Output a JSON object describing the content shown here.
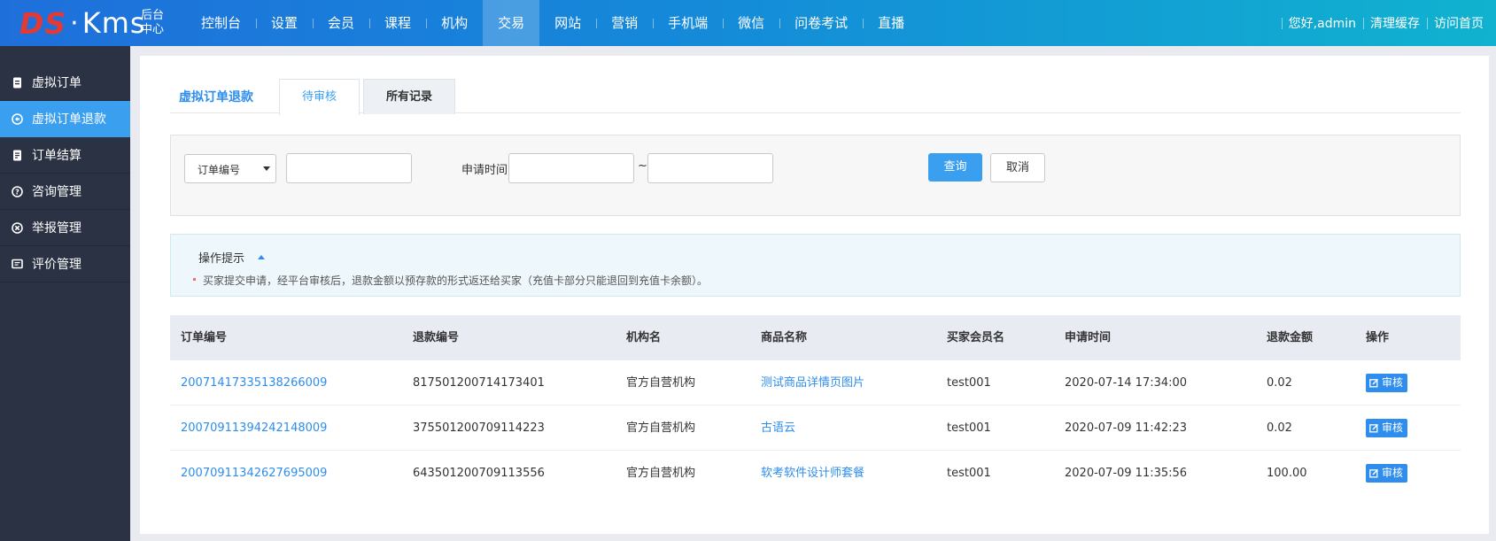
{
  "header": {
    "logo": {
      "ds": "DS",
      "dot": "·",
      "kms": "Kms",
      "sub": "后台中心"
    },
    "nav": [
      {
        "label": "控制台"
      },
      {
        "label": "设置"
      },
      {
        "label": "会员"
      },
      {
        "label": "课程"
      },
      {
        "label": "机构"
      },
      {
        "label": "交易"
      },
      {
        "label": "网站"
      },
      {
        "label": "营销"
      },
      {
        "label": "手机端"
      },
      {
        "label": "微信"
      },
      {
        "label": "问卷考试"
      },
      {
        "label": "直播"
      }
    ],
    "active_nav": "交易",
    "greeting": "您好,admin",
    "clear_cache": "清理缓存",
    "visit_home": "访问首页"
  },
  "sidebar": {
    "items": [
      {
        "label": "虚拟订单",
        "icon": "document-icon"
      },
      {
        "label": "虚拟订单退款",
        "icon": "refund-icon"
      },
      {
        "label": "订单结算",
        "icon": "settlement-icon"
      },
      {
        "label": "咨询管理",
        "icon": "question-icon"
      },
      {
        "label": "举报管理",
        "icon": "report-icon"
      },
      {
        "label": "评价管理",
        "icon": "comment-icon"
      }
    ],
    "active": "虚拟订单退款"
  },
  "tabs": {
    "title": "虚拟订单退款",
    "items": [
      {
        "label": "待审核"
      },
      {
        "label": "所有记录"
      }
    ],
    "active": "待审核"
  },
  "filter": {
    "select_value": "订单编号",
    "search_value": "",
    "date_label": "申请时间",
    "date_sep": "~",
    "date_from": "",
    "date_to": "",
    "query_label": "查询",
    "cancel_label": "取消"
  },
  "tip": {
    "title": "操作提示",
    "text": "买家提交申请，经平台审核后，退款金额以预存款的形式返还给买家（充值卡部分只能退回到充值卡余额）。"
  },
  "table": {
    "columns": [
      "订单编号",
      "退款编号",
      "机构名",
      "商品名称",
      "买家会员名",
      "申请时间",
      "退款金额",
      "操作"
    ],
    "rows": [
      {
        "order_no": "20071417335138266009",
        "refund_no": "817501200714173401",
        "org": "官方自营机构",
        "product": "测试商品详情页图片",
        "buyer": "test001",
        "time": "2020-07-14 17:34:00",
        "amount": "0.02",
        "action": "审核"
      },
      {
        "order_no": "20070911394242148009",
        "refund_no": "375501200709114223",
        "org": "官方自营机构",
        "product": "古语云",
        "buyer": "test001",
        "time": "2020-07-09 11:42:23",
        "amount": "0.02",
        "action": "审核"
      },
      {
        "order_no": "20070911342627695009",
        "refund_no": "643501200709113556",
        "org": "官方自营机构",
        "product": "软考软件设计师套餐",
        "buyer": "test001",
        "time": "2020-07-09 11:35:56",
        "amount": "100.00",
        "action": "审核"
      }
    ]
  },
  "colors": {
    "accent": "#3b9ff0",
    "link": "#2e8ded",
    "sidebar_bg": "#2b3243",
    "logo_red": "#e53935"
  }
}
